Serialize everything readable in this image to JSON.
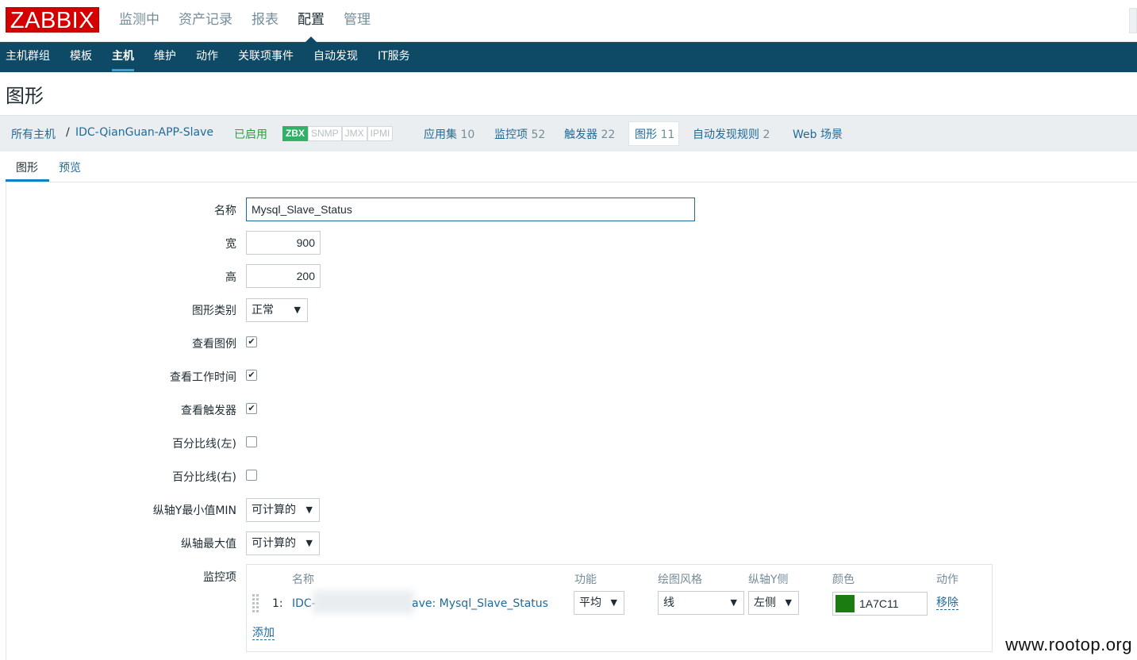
{
  "app": {
    "logo": "ZABBIX"
  },
  "main_nav": [
    "监测中",
    "资产记录",
    "报表",
    "配置",
    "管理"
  ],
  "main_nav_active": "配置",
  "sub_nav": [
    "主机群组",
    "模板",
    "主机",
    "维护",
    "动作",
    "关联项事件",
    "自动发现",
    "IT服务"
  ],
  "sub_nav_active": "主机",
  "page_title": "图形",
  "breadcrumb": {
    "all_hosts": "所有主机",
    "separator": "/",
    "host": "IDC-QianGuan-APP-Slave",
    "status": "已启用",
    "badges": [
      "ZBX",
      "SNMP",
      "JMX",
      "IPMI"
    ],
    "applications": {
      "label": "应用集",
      "count": "10"
    },
    "items": {
      "label": "监控项",
      "count": "52"
    },
    "triggers": {
      "label": "触发器",
      "count": "22"
    },
    "graphs": {
      "label": "图形",
      "count": "11"
    },
    "discovery": {
      "label": "自动发现规则",
      "count": "2"
    },
    "web": "Web 场景"
  },
  "form_tabs": {
    "graph": "图形",
    "preview": "预览"
  },
  "form": {
    "name_label": "名称",
    "name_value": "Mysql_Slave_Status",
    "width_label": "宽",
    "width_value": "900",
    "height_label": "高",
    "height_value": "200",
    "graph_type_label": "图形类别",
    "graph_type_value": "正常",
    "show_legend_label": "查看图例",
    "show_legend": true,
    "show_worktime_label": "查看工作时间",
    "show_worktime": true,
    "show_triggers_label": "查看触发器",
    "show_triggers": true,
    "percentile_left_label": "百分比线(左)",
    "percentile_left": false,
    "percentile_right_label": "百分比线(右)",
    "percentile_right": false,
    "ymin_label": "纵轴Y最小值MIN",
    "ymin_value": "可计算的",
    "ymax_label": "纵轴最大值",
    "ymax_value": "可计算的",
    "items_label": "监控项"
  },
  "items_table": {
    "headers": {
      "name": "名称",
      "function": "功能",
      "draw_style": "绘图风格",
      "y_axis": "纵轴Y侧",
      "color": "颜色",
      "action": "动作"
    },
    "rows": [
      {
        "index": "1:",
        "name_prefix": "IDC-",
        "name_suffix": "ave: Mysql_Slave_Status",
        "function": "平均",
        "draw_style": "线",
        "y_axis": "左侧",
        "color": "1A7C11",
        "color_hex": "#1a7c11",
        "remove": "移除"
      }
    ],
    "add": "添加"
  },
  "watermark": "www.rootop.org",
  "check_mark": "✔",
  "arrow": "▼"
}
